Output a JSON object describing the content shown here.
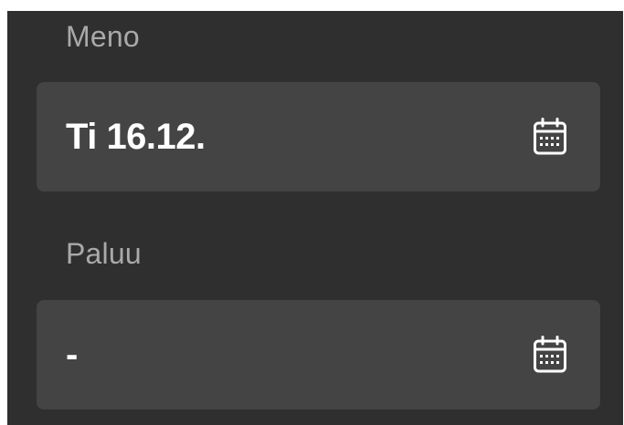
{
  "depart": {
    "label": "Meno",
    "value": "Ti 16.12.",
    "icon": "calendar-icon"
  },
  "return": {
    "label": "Paluu",
    "value": "-",
    "icon": "calendar-icon"
  },
  "colors": {
    "background": "#2f2f2f",
    "field": "#444444",
    "label": "#a9a9a9",
    "value": "#ffffff"
  }
}
